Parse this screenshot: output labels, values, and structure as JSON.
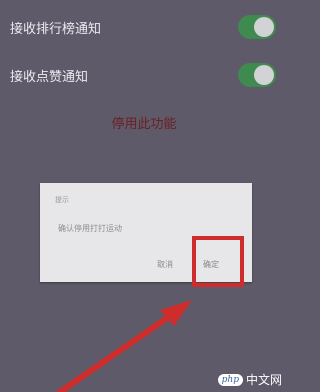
{
  "settings": {
    "rows": [
      {
        "label": "接收排行榜通知",
        "enabled": true
      },
      {
        "label": "接收点赞通知",
        "enabled": true
      }
    ],
    "disable_feature": "停用此功能"
  },
  "dialog": {
    "title": "提示",
    "message": "确认停用打打运动",
    "cancel": "取消",
    "confirm": "确定"
  },
  "watermark": {
    "badge": "php",
    "text": "中文网"
  },
  "colors": {
    "background": "#5e5a69",
    "toggle_on": "#3f8a4e",
    "highlight": "#cf2d2c",
    "disable_text": "#6b1f24"
  }
}
